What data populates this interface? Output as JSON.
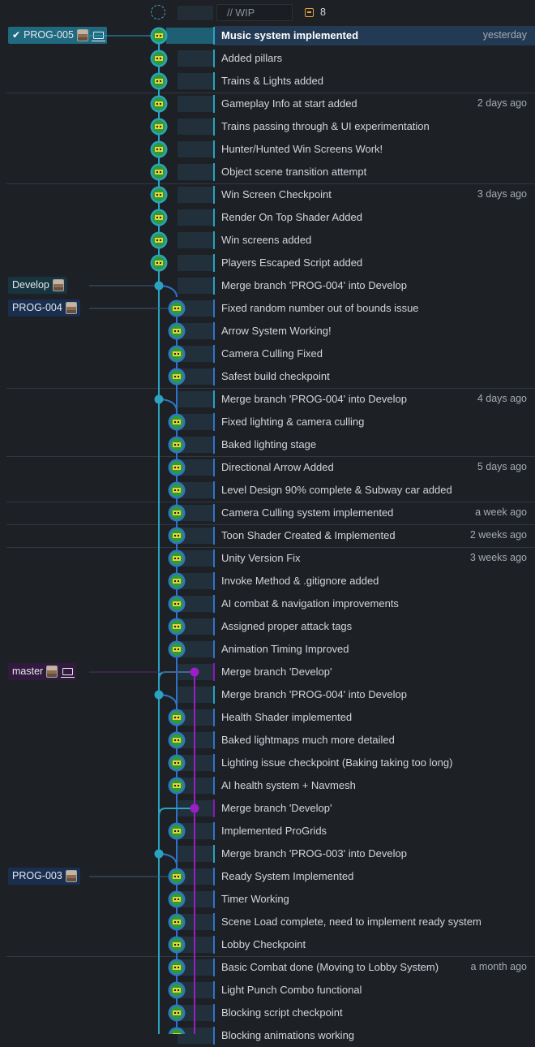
{
  "header": {
    "wip_placeholder": "// WIP",
    "wip_count": "8"
  },
  "refs": [
    {
      "label": "PROG-005",
      "row": 0,
      "style": "prog005",
      "checked": true,
      "laptop": true,
      "color": "#1f6a80"
    },
    {
      "label": "Develop",
      "row": 11,
      "style": "develop",
      "checked": false,
      "laptop": false,
      "color": "#17343f"
    },
    {
      "label": "PROG-004",
      "row": 12,
      "style": "prog004",
      "checked": false,
      "laptop": false,
      "color": "#1a2f50"
    },
    {
      "label": "master",
      "row": 28,
      "style": "master",
      "checked": false,
      "laptop": true,
      "color": "#321a3e"
    },
    {
      "label": "PROG-003",
      "row": 37,
      "style": "prog003",
      "checked": false,
      "laptop": false,
      "color": "#1a2f50"
    }
  ],
  "commits": [
    {
      "message": "Music system implemented",
      "time": "yesterday",
      "lane": 0,
      "kind": "avatar",
      "bar": "#2aa2c0",
      "sep": false,
      "selected": true
    },
    {
      "message": "Added pillars",
      "time": "",
      "lane": 0,
      "kind": "avatar",
      "bar": "#2aa2c0",
      "sep": false
    },
    {
      "message": "Trains & Lights added",
      "time": "",
      "lane": 0,
      "kind": "avatar",
      "bar": "#2aa2c0",
      "sep": false
    },
    {
      "message": "Gameplay Info at start added",
      "time": "2 days ago",
      "lane": 0,
      "kind": "avatar",
      "bar": "#2aa2c0",
      "sep": true
    },
    {
      "message": "Trains passing through & UI experimentation",
      "time": "",
      "lane": 0,
      "kind": "avatar",
      "bar": "#2aa2c0",
      "sep": false
    },
    {
      "message": "Hunter/Hunted Win Screens Work!",
      "time": "",
      "lane": 0,
      "kind": "avatar",
      "bar": "#2aa2c0",
      "sep": false
    },
    {
      "message": "Object scene transition attempt",
      "time": "",
      "lane": 0,
      "kind": "avatar",
      "bar": "#2aa2c0",
      "sep": false
    },
    {
      "message": "Win Screen Checkpoint",
      "time": "3 days ago",
      "lane": 0,
      "kind": "avatar",
      "bar": "#2aa2c0",
      "sep": true
    },
    {
      "message": "Render On Top Shader Added",
      "time": "",
      "lane": 0,
      "kind": "avatar",
      "bar": "#2aa2c0",
      "sep": false
    },
    {
      "message": "Win screens added",
      "time": "",
      "lane": 0,
      "kind": "avatar",
      "bar": "#2aa2c0",
      "sep": false
    },
    {
      "message": "Players Escaped Script added",
      "time": "",
      "lane": 0,
      "kind": "avatar",
      "bar": "#2aa2c0",
      "sep": false
    },
    {
      "message": "Merge branch 'PROG-004' into Develop",
      "time": "",
      "lane": 0,
      "kind": "dot",
      "bar": "#2aa2c0",
      "sep": false
    },
    {
      "message": "Fixed random number out of bounds issue",
      "time": "",
      "lane": 1,
      "kind": "avatar",
      "bar": "#2f74c8",
      "sep": false
    },
    {
      "message": "Arrow System Working!",
      "time": "",
      "lane": 1,
      "kind": "avatar",
      "bar": "#2f74c8",
      "sep": false
    },
    {
      "message": "Camera Culling Fixed",
      "time": "",
      "lane": 1,
      "kind": "avatar",
      "bar": "#2f74c8",
      "sep": false
    },
    {
      "message": "Safest build checkpoint",
      "time": "",
      "lane": 1,
      "kind": "avatar",
      "bar": "#2f74c8",
      "sep": false
    },
    {
      "message": "Merge branch 'PROG-004' into Develop",
      "time": "4 days ago",
      "lane": 0,
      "kind": "dot",
      "bar": "#2aa2c0",
      "sep": true
    },
    {
      "message": "Fixed lighting & camera culling",
      "time": "",
      "lane": 1,
      "kind": "avatar",
      "bar": "#2f74c8",
      "sep": false
    },
    {
      "message": "Baked lighting stage",
      "time": "",
      "lane": 1,
      "kind": "avatar",
      "bar": "#2f74c8",
      "sep": false
    },
    {
      "message": "Directional Arrow Added",
      "time": "5 days ago",
      "lane": 1,
      "kind": "avatar",
      "bar": "#2f74c8",
      "sep": true
    },
    {
      "message": "Level Design 90% complete & Subway car added",
      "time": "",
      "lane": 1,
      "kind": "avatar",
      "bar": "#2f74c8",
      "sep": false
    },
    {
      "message": "Camera Culling system implemented",
      "time": "a week ago",
      "lane": 1,
      "kind": "avatar",
      "bar": "#2f74c8",
      "sep": true
    },
    {
      "message": "Toon Shader Created & Implemented",
      "time": "2 weeks ago",
      "lane": 1,
      "kind": "avatar",
      "bar": "#2f74c8",
      "sep": true
    },
    {
      "message": "Unity Version Fix",
      "time": "3 weeks ago",
      "lane": 1,
      "kind": "avatar",
      "bar": "#2f74c8",
      "sep": true
    },
    {
      "message": "Invoke Method & .gitignore added",
      "time": "",
      "lane": 1,
      "kind": "avatar",
      "bar": "#2f74c8",
      "sep": false
    },
    {
      "message": "AI combat & navigation improvements",
      "time": "",
      "lane": 1,
      "kind": "avatar",
      "bar": "#2f74c8",
      "sep": false
    },
    {
      "message": "Assigned proper attack tags",
      "time": "",
      "lane": 1,
      "kind": "avatar",
      "bar": "#2f74c8",
      "sep": false
    },
    {
      "message": "Animation Timing Improved",
      "time": "",
      "lane": 1,
      "kind": "avatar",
      "bar": "#2f74c8",
      "sep": false
    },
    {
      "message": "Merge branch 'Develop'",
      "time": "",
      "lane": 2,
      "kind": "dot",
      "bar": "#8a18b8",
      "sep": false
    },
    {
      "message": "Merge branch 'PROG-004' into Develop",
      "time": "",
      "lane": 0,
      "kind": "dot",
      "bar": "#2aa2c0",
      "sep": false
    },
    {
      "message": "Health Shader implemented",
      "time": "",
      "lane": 1,
      "kind": "avatar",
      "bar": "#2f74c8",
      "sep": false
    },
    {
      "message": "Baked lightmaps much more detailed",
      "time": "",
      "lane": 1,
      "kind": "avatar",
      "bar": "#2f74c8",
      "sep": false
    },
    {
      "message": "Lighting issue checkpoint (Baking taking too long)",
      "time": "",
      "lane": 1,
      "kind": "avatar",
      "bar": "#2f74c8",
      "sep": false
    },
    {
      "message": "AI health system + Navmesh",
      "time": "",
      "lane": 1,
      "kind": "avatar",
      "bar": "#2f74c8",
      "sep": false
    },
    {
      "message": "Merge branch 'Develop'",
      "time": "",
      "lane": 2,
      "kind": "dot",
      "bar": "#8a18b8",
      "sep": false
    },
    {
      "message": "Implemented ProGrids",
      "time": "",
      "lane": 1,
      "kind": "avatar",
      "bar": "#2f74c8",
      "sep": false
    },
    {
      "message": "Merge branch 'PROG-003' into Develop",
      "time": "",
      "lane": 0,
      "kind": "dot",
      "bar": "#2aa2c0",
      "sep": false
    },
    {
      "message": "Ready System Implemented",
      "time": "",
      "lane": 1,
      "kind": "avatar",
      "bar": "#2f74c8",
      "sep": false
    },
    {
      "message": "Timer Working",
      "time": "",
      "lane": 1,
      "kind": "avatar",
      "bar": "#2f74c8",
      "sep": false
    },
    {
      "message": "Scene Load complete, need to implement ready system",
      "time": "",
      "lane": 1,
      "kind": "avatar",
      "bar": "#2f74c8",
      "sep": false
    },
    {
      "message": "Lobby Checkpoint",
      "time": "",
      "lane": 1,
      "kind": "avatar",
      "bar": "#2f74c8",
      "sep": false
    },
    {
      "message": "Basic Combat done (Moving to Lobby System)",
      "time": "a month ago",
      "lane": 1,
      "kind": "avatar",
      "bar": "#2f74c8",
      "sep": true
    },
    {
      "message": "Light Punch Combo functional",
      "time": "",
      "lane": 1,
      "kind": "avatar",
      "bar": "#2f74c8",
      "sep": false
    },
    {
      "message": "Blocking script checkpoint",
      "time": "",
      "lane": 1,
      "kind": "avatar",
      "bar": "#2f74c8",
      "sep": false
    },
    {
      "message": "Blocking animations working",
      "time": "",
      "lane": 1,
      "kind": "avatar",
      "bar": "#2f74c8",
      "sep": false
    }
  ],
  "colors": {
    "lane0": "#2aa2c0",
    "lane1": "#2f74c8",
    "lane2": "#9a1fc4",
    "selected_bg": "#233a55",
    "avatar_ring": "#2aa0c0"
  }
}
